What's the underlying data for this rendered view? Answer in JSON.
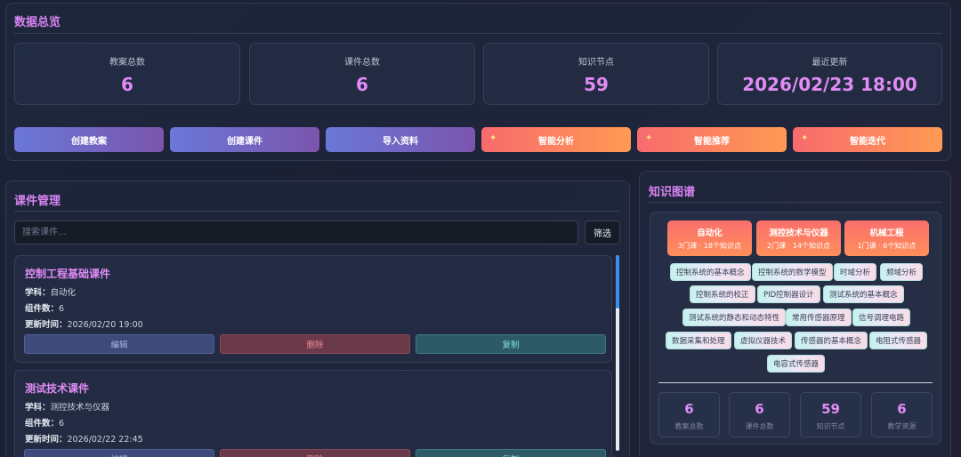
{
  "overview": {
    "title": "数据总览",
    "stats": [
      {
        "label": "教案总数",
        "value": "6"
      },
      {
        "label": "课件总数",
        "value": "6"
      },
      {
        "label": "知识节点",
        "value": "59"
      },
      {
        "label": "最近更新",
        "value": "2026/02/23 18:00"
      }
    ],
    "actions": [
      {
        "label": "创建教案",
        "style": "blue"
      },
      {
        "label": "创建课件",
        "style": "blue"
      },
      {
        "label": "导入资料",
        "style": "blue"
      },
      {
        "label": "智能分析",
        "style": "orange",
        "icon": "sparkle-icon"
      },
      {
        "label": "智能推荐",
        "style": "orange",
        "icon": "sparkle-icon"
      },
      {
        "label": "智能迭代",
        "style": "orange",
        "icon": "sparkle-icon"
      }
    ]
  },
  "courseware": {
    "title": "课件管理",
    "search_placeholder": "搜索课件...",
    "filter_label": "筛选",
    "courses": [
      {
        "title": "控制工程基础课件",
        "subject_key": "学科：",
        "subject": "自动化",
        "components_key": "组件数：",
        "components": "6",
        "updated_key": "更新时间：",
        "updated": "2026/02/20 19:00",
        "edit_label": "编辑",
        "delete_label": "删除",
        "copy_label": "复制"
      },
      {
        "title": "测试技术课件",
        "subject_key": "学科：",
        "subject": "测控技术与仪器",
        "components_key": "组件数：",
        "components": "6",
        "updated_key": "更新时间：",
        "updated": "2026/02/22 22:45",
        "edit_label": "编辑",
        "delete_label": "删除",
        "copy_label": "复制"
      }
    ]
  },
  "knowledge": {
    "title": "知识图谱",
    "categories": [
      {
        "name": "自动化",
        "summary": "3门课 · 18个知识点"
      },
      {
        "name": "测控技术与仪器",
        "summary": "2门课 · 14个知识点"
      },
      {
        "name": "机械工程",
        "summary": "1门课 · 6个知识点"
      }
    ],
    "tags": [
      "控制系统的基本概念",
      "控制系统的数学模型",
      "时域分析",
      "频域分析",
      "控制系统的校正",
      "PID控制器设计",
      "测试系统的基本概念",
      "测试系统的静态和动态特性",
      "常用传感器原理",
      "信号调理电路",
      "数据采集和处理",
      "虚拟仪器技术",
      "传感器的基本概念",
      "电阻式传感器",
      "电容式传感器"
    ],
    "stats": [
      {
        "value": "6",
        "label": "教案总数"
      },
      {
        "value": "6",
        "label": "课件总数"
      },
      {
        "value": "59",
        "label": "知识节点"
      },
      {
        "value": "6",
        "label": "教学资源"
      }
    ]
  },
  "colors": {
    "accent": "#e08cf5",
    "primary_button": "#6a78d8",
    "ai_button": "#f86b6e"
  }
}
